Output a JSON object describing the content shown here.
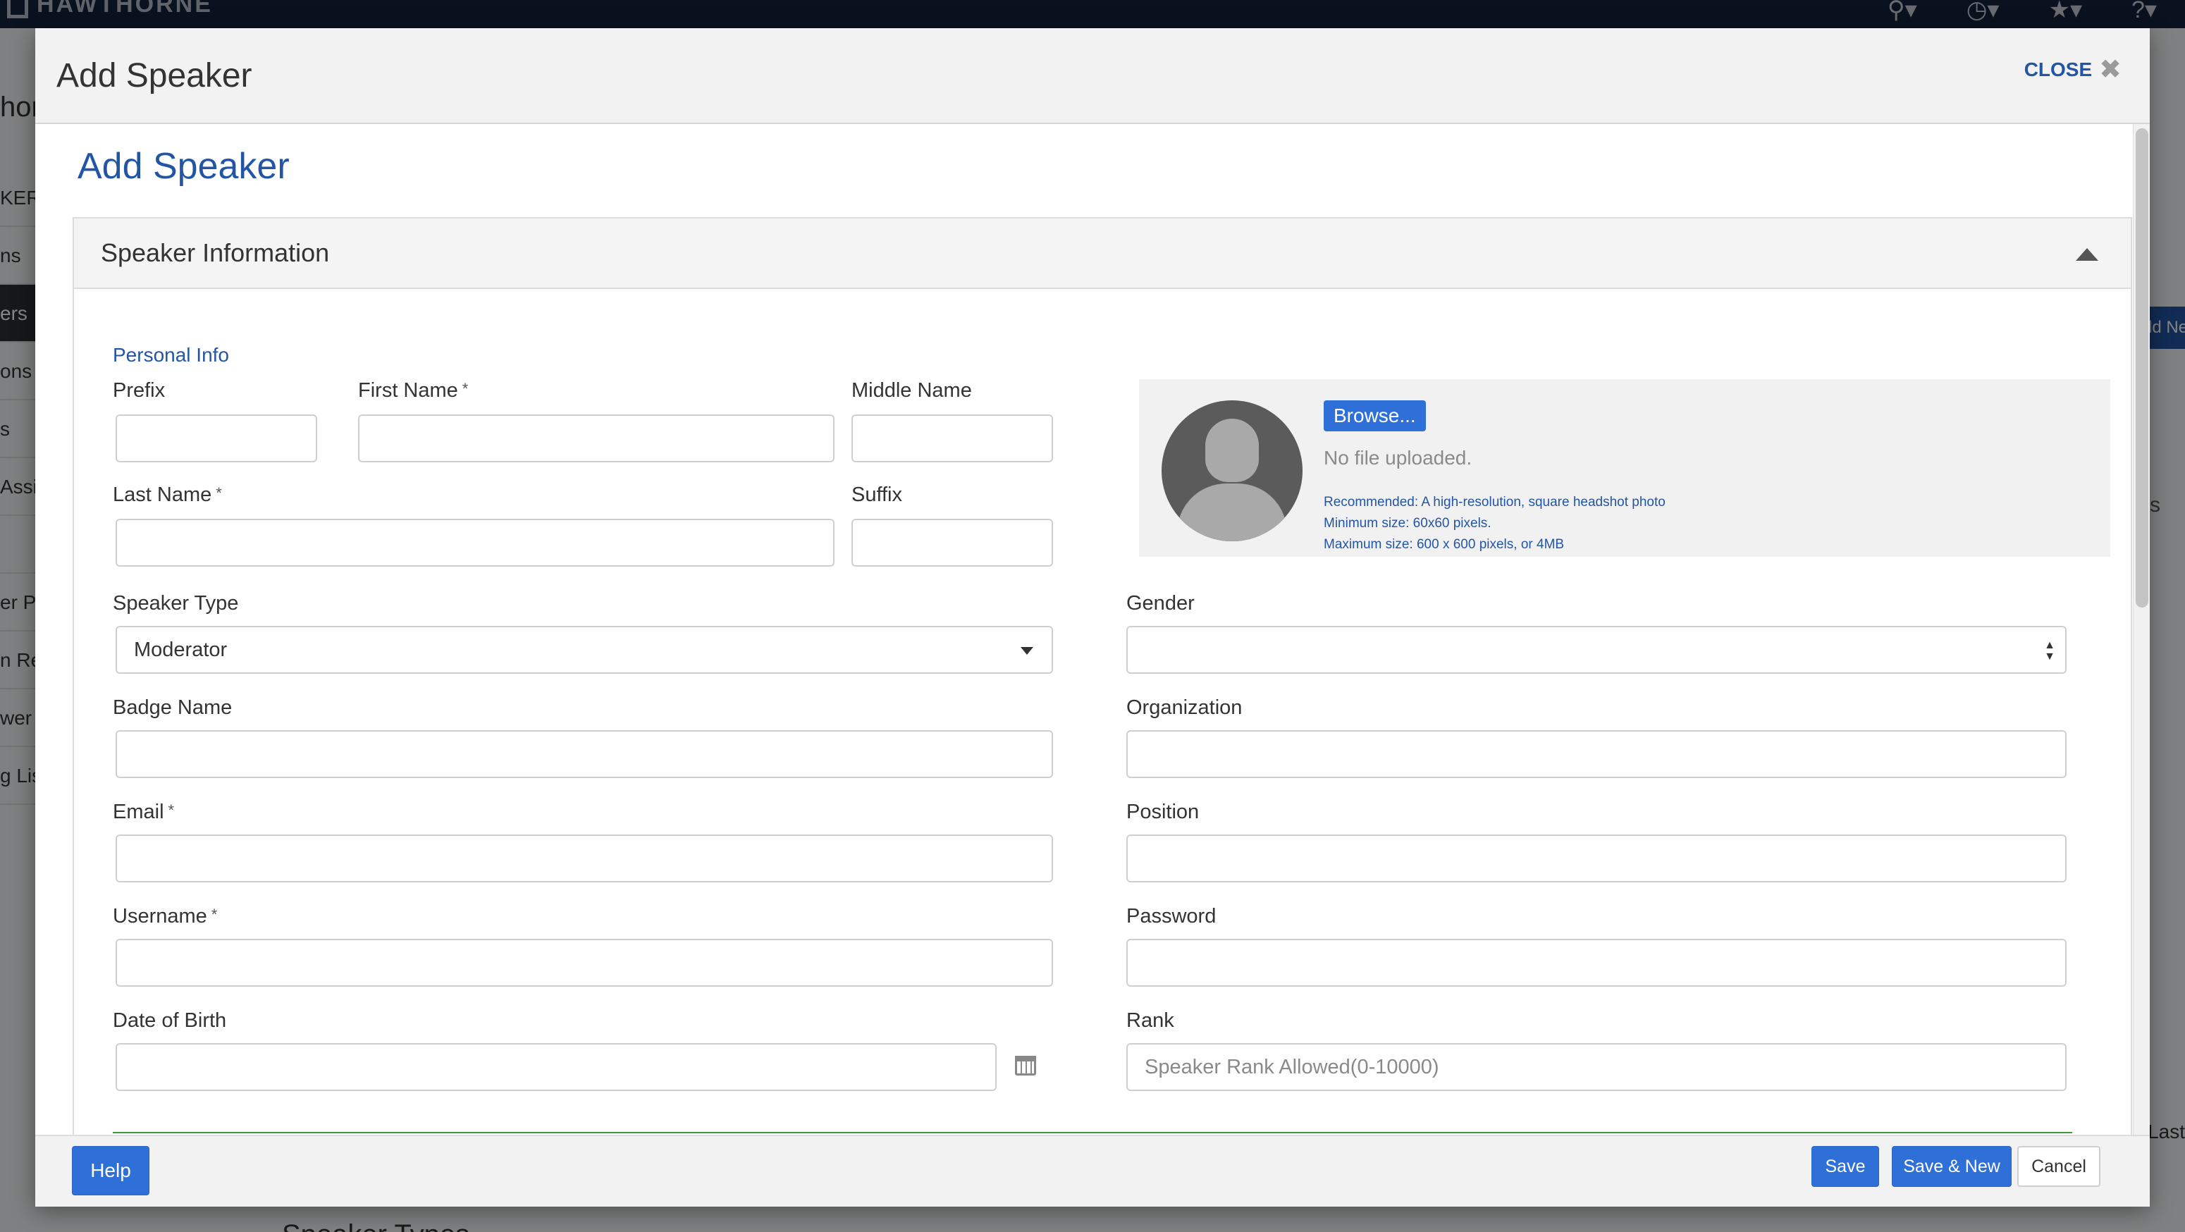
{
  "background": {
    "brand": "HAWTHORNE",
    "page_title_fragment": "hor",
    "sidebar_fragments": [
      "KERS",
      "ns",
      "ers",
      "ons",
      "s",
      "Assig",
      "",
      "er Po",
      "n Re",
      "wer",
      "g Lis"
    ],
    "right_button_fragment": "dd Ne",
    "right_column_fragment": "s",
    "last_fragment": "Last",
    "bottom_heading": "Speaker Types"
  },
  "modal": {
    "title": "Add Speaker",
    "close_label": "CLOSE"
  },
  "form": {
    "heading": "Add Speaker",
    "panel_title": "Speaker Information",
    "section_personal": "Personal Info",
    "required_mark": "*",
    "labels": {
      "prefix": "Prefix",
      "first_name": "First Name",
      "middle_name": "Middle Name",
      "last_name": "Last Name",
      "suffix": "Suffix",
      "speaker_type": "Speaker Type",
      "gender": "Gender",
      "badge_name": "Badge Name",
      "organization": "Organization",
      "email": "Email",
      "position": "Position",
      "username": "Username",
      "password": "Password",
      "date_of_birth": "Date of Birth",
      "rank": "Rank"
    },
    "values": {
      "speaker_type": "Moderator",
      "gender": ""
    },
    "placeholders": {
      "rank": "Speaker Rank Allowed(0-10000)"
    },
    "photo": {
      "browse_label": "Browse...",
      "status": "No file uploaded.",
      "hint_recommended": "Recommended: A high-resolution, square headshot photo",
      "hint_min": "Minimum size: 60x60 pixels.",
      "hint_max": "Maximum size: 600 x 600 pixels, or 4MB"
    }
  },
  "footer": {
    "help": "Help",
    "save": "Save",
    "save_new": "Save & New",
    "cancel": "Cancel"
  },
  "colors": {
    "accent": "#2355a5",
    "primary_button": "#2e6fd8",
    "topbar": "#16233c",
    "divider_green": "#3c9a3c"
  },
  "icons": [
    "search-icon",
    "history-icon",
    "star-icon",
    "help-icon",
    "close-icon",
    "collapse-caret-icon",
    "dropdown-caret-icon",
    "calendar-icon",
    "avatar-placeholder-icon"
  ]
}
